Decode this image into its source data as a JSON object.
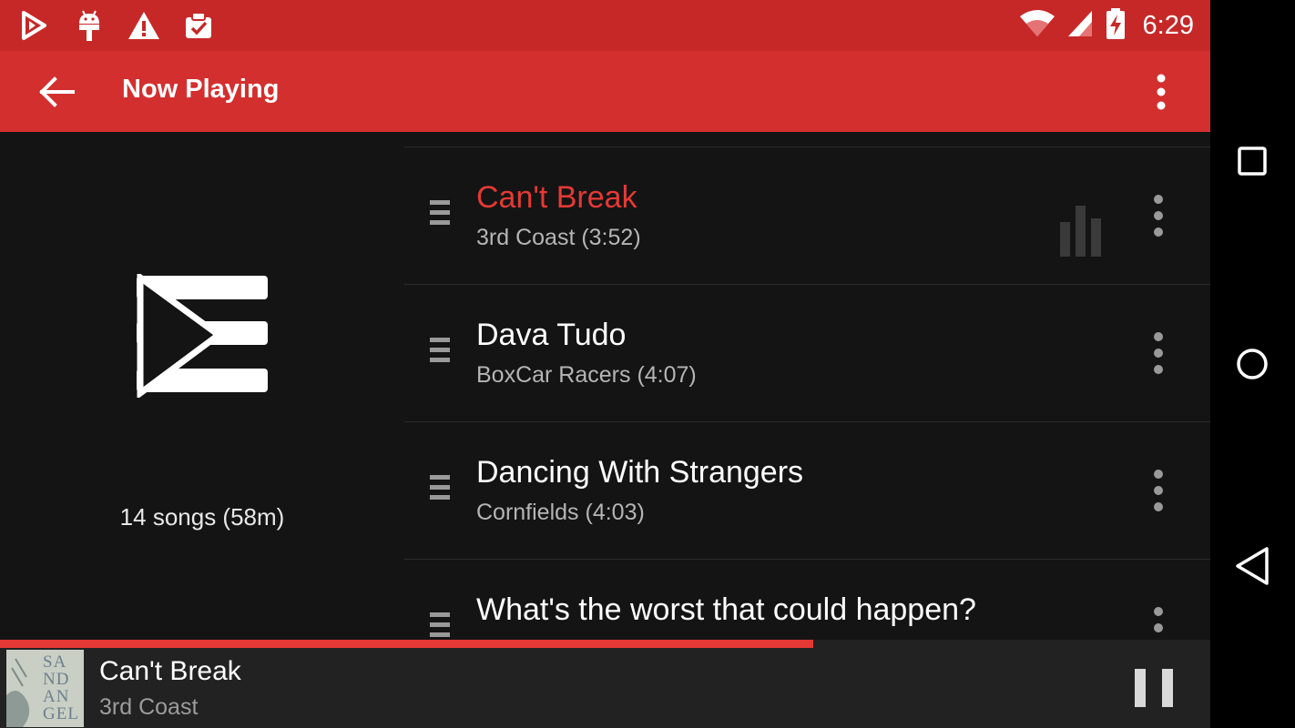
{
  "status_bar": {
    "time": "6:29",
    "left_icons": [
      "play-store-icon",
      "android-debug-icon",
      "warning-icon",
      "clipboard-check-icon"
    ],
    "right_icons": [
      "wifi-icon",
      "cell-signal-icon",
      "battery-charging-icon"
    ]
  },
  "toolbar": {
    "title": "Now Playing",
    "back_icon": "arrow-back-icon",
    "overflow_icon": "more-vert-icon"
  },
  "playlist_info": {
    "summary": "14 songs (58m)"
  },
  "queue": {
    "items": [
      {
        "title": "Can't Break",
        "subtitle": "3rd Coast (3:52)",
        "playing": true
      },
      {
        "title": "Dava Tudo",
        "subtitle": "BoxCar Racers (4:07)",
        "playing": false
      },
      {
        "title": "Dancing With Strangers",
        "subtitle": "Cornfields (4:03)",
        "playing": false
      },
      {
        "title": "What's the worst that could happen?",
        "subtitle": "",
        "playing": false
      }
    ]
  },
  "mini_player": {
    "title": "Can't Break",
    "artist": "3rd Coast",
    "album_art_text": [
      "SA",
      "ND",
      "AN",
      "GEL"
    ],
    "progress": 0.672,
    "pause_icon": "pause-icon"
  },
  "nav_bar": {
    "icons": [
      "recents-square-icon",
      "home-circle-icon",
      "back-triangle-icon"
    ]
  },
  "colors": {
    "status_bar": "#c62828",
    "toolbar": "#d32f2f",
    "accent": "#e53935",
    "background": "#141414"
  }
}
